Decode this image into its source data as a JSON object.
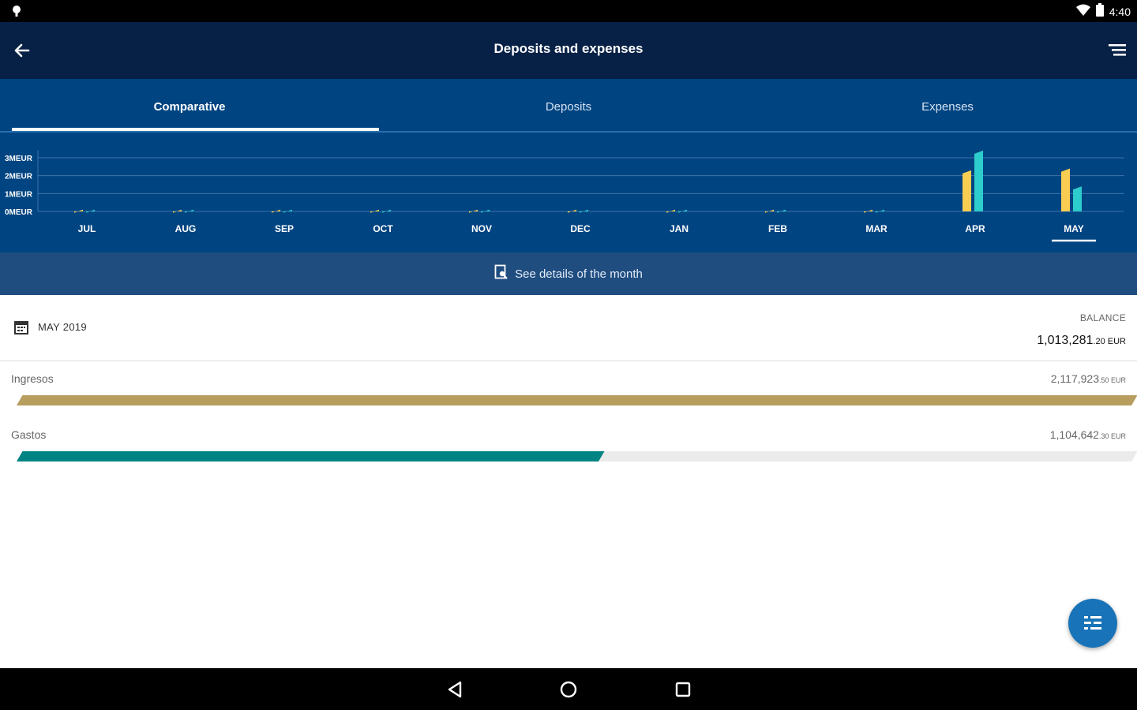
{
  "status_bar": {
    "time": "4:40"
  },
  "header": {
    "title": "Deposits and expenses"
  },
  "tabs": [
    {
      "label": "Comparative",
      "active": true
    },
    {
      "label": "Deposits",
      "active": false
    },
    {
      "label": "Expenses",
      "active": false
    }
  ],
  "chart_data": {
    "type": "bar",
    "y_tick_labels": [
      "0MEUR",
      "1MEUR",
      "2MEUR",
      "3MEUR"
    ],
    "ylim": [
      0,
      3.3
    ],
    "categories": [
      "JUL",
      "AUG",
      "SEP",
      "OCT",
      "NOV",
      "DEC",
      "JAN",
      "FEB",
      "MAR",
      "APR",
      "MAY"
    ],
    "selected_category": "MAY",
    "series": [
      {
        "color": "#f8cd51",
        "values": [
          0.1,
          0.1,
          0.1,
          0.1,
          0.1,
          0.1,
          0.1,
          0.1,
          0.1,
          2.3,
          2.4
        ]
      },
      {
        "color": "#2dcccd",
        "values": [
          0.1,
          0.1,
          0.1,
          0.1,
          0.1,
          0.1,
          0.1,
          0.1,
          0.1,
          3.4,
          1.4
        ]
      }
    ]
  },
  "details_link": {
    "label": "See details of the month"
  },
  "summary": {
    "month": "MAY 2019",
    "balance_label": "BALANCE",
    "balance_main": "1,013,281",
    "balance_decimals": ".20 EUR"
  },
  "rows": [
    {
      "label": "Ingresos",
      "amount_main": "2,117,923",
      "amount_decimals": ".50 EUR",
      "fill_fraction": 1.0,
      "color": "#b79e5e"
    },
    {
      "label": "Gastos",
      "amount_main": "1,104,642",
      "amount_decimals": ".30 EUR",
      "fill_fraction": 0.522,
      "color": "#028484"
    }
  ],
  "colors": {
    "appbar": "#072146",
    "tabs": "#004481",
    "fab": "#1973b8"
  }
}
